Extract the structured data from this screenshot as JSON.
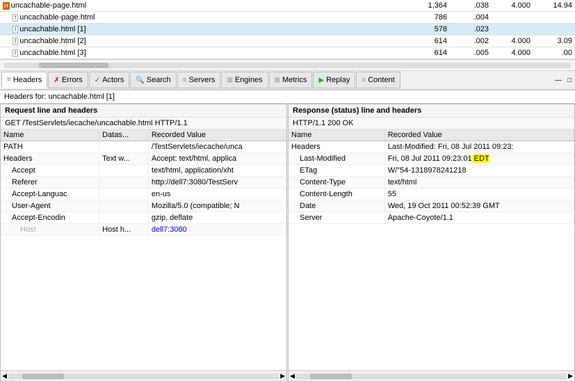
{
  "topTable": {
    "rows": [
      {
        "indent": 0,
        "icon": "html",
        "name": "uncachable-page.html",
        "size": "1,364",
        "time": ".038",
        "conn": "4.000",
        "total": "14.94",
        "highlight": false
      },
      {
        "indent": 1,
        "icon": "sub",
        "name": "uncachable-page.html",
        "size": "786",
        "time": ".004",
        "conn": "",
        "total": "",
        "highlight": false
      },
      {
        "indent": 1,
        "icon": "sub",
        "name": "uncachable.html [1]",
        "size": "578",
        "time": ".023",
        "conn": "",
        "total": "",
        "highlight": true
      },
      {
        "indent": 1,
        "icon": "sub",
        "name": "uncachable.html [2]",
        "size": "614",
        "time": ".002",
        "conn": "4.000",
        "total": "3.09",
        "highlight": false
      },
      {
        "indent": 1,
        "icon": "sub",
        "name": "uncachable.html [3]",
        "size": "614",
        "time": ".005",
        "conn": "4.000",
        "total": ".00",
        "highlight": false
      }
    ]
  },
  "tabs": [
    {
      "id": "headers",
      "icon": "≡",
      "label": "Headers",
      "iconColor": "#4488cc",
      "active": true
    },
    {
      "id": "errors",
      "icon": "✗",
      "label": "Errors",
      "iconColor": "#cc0000",
      "active": false
    },
    {
      "id": "actors",
      "icon": "✓",
      "label": "Actors",
      "iconColor": "#228822",
      "active": false
    },
    {
      "id": "search",
      "icon": "🔍",
      "label": "Search",
      "iconColor": "#444",
      "active": false
    },
    {
      "id": "servers",
      "icon": "≡",
      "label": "Servers",
      "iconColor": "#888",
      "active": false
    },
    {
      "id": "engines",
      "icon": "⊞",
      "label": "Engines",
      "iconColor": "#888",
      "active": false
    },
    {
      "id": "metrics",
      "icon": "⊞",
      "label": "Metrics",
      "iconColor": "#888",
      "active": false
    },
    {
      "id": "replay",
      "icon": "▶",
      "label": "Replay",
      "iconColor": "#22aa22",
      "active": false
    },
    {
      "id": "content",
      "icon": "≡",
      "label": "Content",
      "iconColor": "#888",
      "active": false
    }
  ],
  "headersFor": "Headers for: uncachable.html [1]",
  "leftPanel": {
    "sectionTitle": "Request line and headers",
    "subtitle": "GET /TestServlets/iecache/uncachable.html HTTP/1.1",
    "columns": [
      "Name",
      "Datas...",
      "Recorded Value"
    ],
    "rows": [
      {
        "indent": 0,
        "name": "PATH",
        "dataSource": "",
        "value": "/TestServlets/iecache/unca",
        "highlight": false
      },
      {
        "indent": 0,
        "name": "Headers",
        "dataSource": "Text w...",
        "value": "Accept: text/html, applica",
        "highlight": true
      },
      {
        "indent": 1,
        "name": "Accept",
        "dataSource": "",
        "value": "text/html, application/xht",
        "highlight": false
      },
      {
        "indent": 1,
        "name": "Referer",
        "dataSource": "",
        "value": "http://dell7:3080/TestServ",
        "highlight": false
      },
      {
        "indent": 1,
        "name": "Accept-Languac",
        "dataSource": "",
        "value": "en-us",
        "highlight": false
      },
      {
        "indent": 1,
        "name": "User-Agent",
        "dataSource": "",
        "value": "Mozilla/5.0 (compatible; N",
        "highlight": false
      },
      {
        "indent": 1,
        "name": "Accept-Encodin",
        "dataSource": "",
        "value": "gzip, deflate",
        "highlight": false
      },
      {
        "indent": 2,
        "name": "Host",
        "dataSource": "Host h...",
        "value": "dell7:3080",
        "highlight": false,
        "nameGray": true
      }
    ]
  },
  "rightPanel": {
    "sectionTitle": "Response (status) line and headers",
    "subtitle": "HTTP/1.1 200 OK",
    "columns": [
      "Name",
      "Recorded Value"
    ],
    "rows": [
      {
        "indent": 0,
        "name": "Headers",
        "value": "Last-Modified: Fri, 08 Jul 2011 09:23:",
        "highlight": false
      },
      {
        "indent": 1,
        "name": "Last-Modified",
        "value": "Fri, 08 Jul 2011 09:23:01",
        "valueSuffix": " EDT",
        "suffixHighlight": true,
        "highlight": false
      },
      {
        "indent": 1,
        "name": "ETag",
        "value": "W/\"54-1318978241218",
        "highlight": false
      },
      {
        "indent": 1,
        "name": "Content-Type",
        "value": "text/html",
        "highlight": false
      },
      {
        "indent": 1,
        "name": "Content-Length",
        "value": "55",
        "highlight": false
      },
      {
        "indent": 1,
        "name": "Date",
        "value": "Wed, 19 Oct 2011 00:52:39 GMT",
        "highlight": false
      },
      {
        "indent": 1,
        "name": "Server",
        "value": "Apache-Coyote/1.1",
        "highlight": false
      }
    ]
  }
}
